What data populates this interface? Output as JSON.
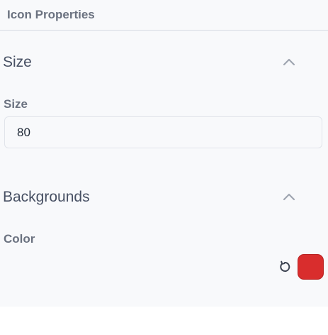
{
  "panel": {
    "title": "Icon Properties"
  },
  "size_section": {
    "title": "Size",
    "collapse_icon": "chevron-up-icon",
    "field": {
      "label": "Size",
      "value": "80"
    }
  },
  "backgrounds_section": {
    "title": "Backgrounds",
    "collapse_icon": "chevron-up-icon",
    "color": {
      "label": "Color",
      "reset_icon": "reset-icon",
      "swatch_color": "#d92d2d",
      "swatch_border": "#b82323"
    }
  }
}
